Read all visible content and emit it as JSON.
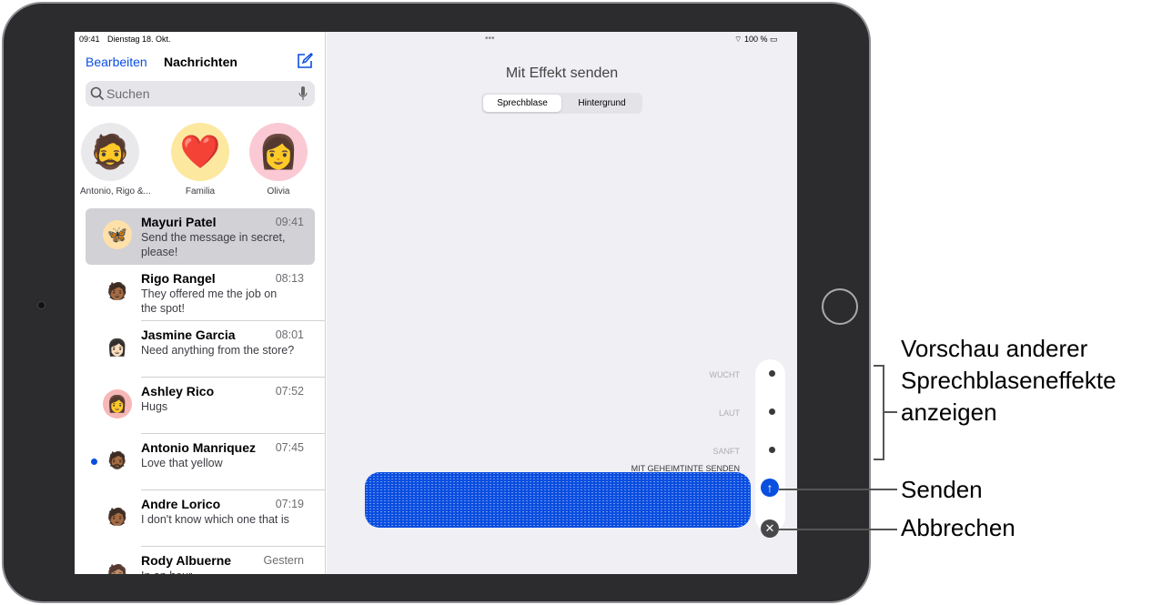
{
  "status": {
    "time": "09:41",
    "date": "Dienstag 18. Okt.",
    "battery": "100 %",
    "dots": "•••"
  },
  "sidebar": {
    "edit": "Bearbeiten",
    "title": "Nachrichten",
    "search_placeholder": "Suchen",
    "pinned": [
      {
        "label": "Antonio, Rigo &...",
        "emoji": "🧔"
      },
      {
        "label": "Familia",
        "emoji": "❤️"
      },
      {
        "label": "Olivia",
        "emoji": "👩"
      }
    ],
    "conversations": [
      {
        "name": "Mayuri Patel",
        "time": "09:41",
        "preview": "Send the message in secret, please!",
        "emoji": "🦋",
        "bg": "#ffe0a8"
      },
      {
        "name": "Rigo Rangel",
        "time": "08:13",
        "preview": "They offered me the job on the spot!",
        "emoji": "🧑🏾",
        "bg": "#fff"
      },
      {
        "name": "Jasmine Garcia",
        "time": "08:01",
        "preview": "Need anything from the store?",
        "emoji": "👩🏻",
        "bg": "#fff"
      },
      {
        "name": "Ashley Rico",
        "time": "07:52",
        "preview": "Hugs",
        "emoji": "👩",
        "bg": "#f7b7b7"
      },
      {
        "name": "Antonio Manriquez",
        "time": "07:45",
        "preview": "Love that yellow",
        "emoji": "🧔🏾",
        "bg": "#fff"
      },
      {
        "name": "Andre Lorico",
        "time": "07:19",
        "preview": "I don't know which one that is",
        "emoji": "🧑🏾",
        "bg": "#fff"
      },
      {
        "name": "Rody Albuerne",
        "time": "Gestern",
        "preview": "In an hour",
        "emoji": "🧑🏽",
        "bg": "#fff"
      }
    ]
  },
  "main": {
    "title": "Mit Effekt senden",
    "tabs": [
      "Sprechblase",
      "Hintergrund"
    ],
    "selected_tab": "Sprechblase",
    "effects": [
      "WUCHT",
      "LAUT",
      "SANFT",
      "MIT GEHEIMTINTE SENDEN"
    ],
    "accent": "#0a4ee0"
  },
  "annotations": {
    "preview": "Vorschau anderer Sprechblaseneffekte anzeigen",
    "send": "Senden",
    "cancel": "Abbrechen"
  }
}
